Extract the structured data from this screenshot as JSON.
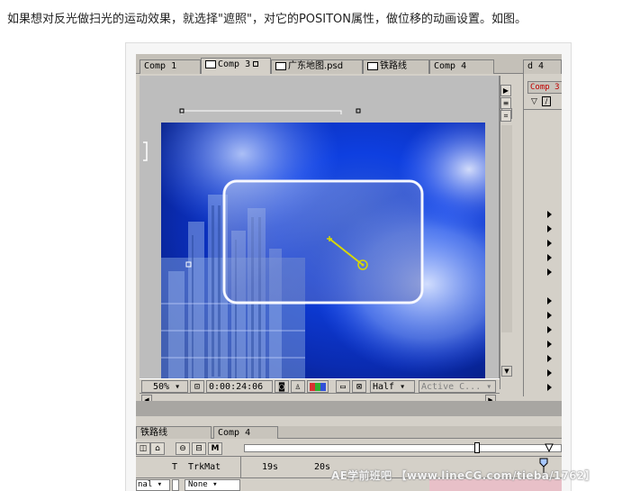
{
  "caption": "如果想对反光做扫光的运动效果，就选择\"遮照\"，对它的POSITON属性，做位移的动画设置。如图。",
  "comp_window": {
    "tabs": [
      {
        "label": "Comp 1"
      },
      {
        "label": "Comp 3",
        "active": true
      },
      {
        "label": "广东地图.psd"
      },
      {
        "label": "铁路线"
      },
      {
        "label": "Comp 4"
      }
    ],
    "right_tab_fragment": "d 4"
  },
  "viewer_controls": {
    "zoom": "50%",
    "timecode": "0:00:24:06",
    "resolution": "Half",
    "camera": "Active C..."
  },
  "right_panel": {
    "tab_label": "Comp 3"
  },
  "timeline": {
    "tabs": [
      {
        "label": "铁路线"
      },
      {
        "label": "Comp 4"
      }
    ],
    "tool_m_label": "M",
    "column_header": "T  TrkMat",
    "ruler_labels": [
      "19s",
      "20s"
    ],
    "mode_value": "nal",
    "trkmat_value": "None"
  },
  "watermark": "AE学前班吧 【www.lineCG.com/tieba/1762】",
  "colors": {
    "ui_gray": "#d4d0c8",
    "track_yellow": "#d8d800",
    "image_blue": "#1446e0"
  }
}
